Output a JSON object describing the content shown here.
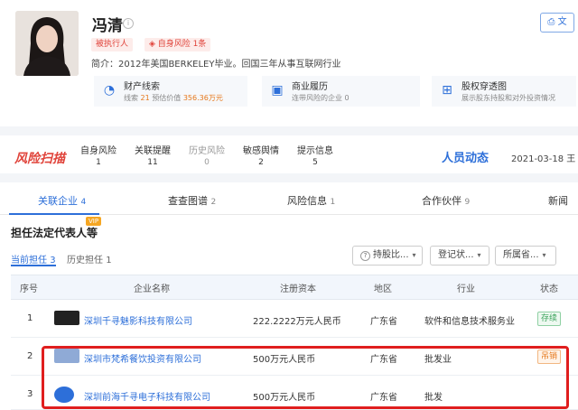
{
  "profile": {
    "name": "冯清",
    "tags": [
      "被执行人",
      "自身风险 1条"
    ],
    "intro": "简介：2012年美国BERKELEY毕业。回国三年从事互联网行业",
    "metrics": [
      {
        "icon": "finance-icon",
        "title": "财产线索",
        "line_prefix": "线索",
        "line_count": "21",
        "line_mid": "预估价值",
        "line_value": "356.36万元"
      },
      {
        "icon": "briefcase-icon",
        "title": "商业履历",
        "line_prefix": "连带风险的企业",
        "line_count": "0"
      },
      {
        "icon": "org-chart-icon",
        "title": "股权穿透图",
        "line_prefix": "展示股东持股和对外投资情况"
      }
    ],
    "doc_btn": "文"
  },
  "risk": {
    "logo": "风险扫描",
    "columns": [
      {
        "label": "自身风险",
        "value": "1"
      },
      {
        "label": "关联提醒",
        "value": "11"
      },
      {
        "label": "历史风险",
        "value": "0"
      },
      {
        "label": "敏感舆情",
        "value": "2"
      },
      {
        "label": "提示信息",
        "value": "5"
      }
    ],
    "people_label": "人员动态",
    "date": "2021-03-18 王"
  },
  "tabs": [
    {
      "label": "关联企业",
      "count": "4"
    },
    {
      "label": "查查图谱",
      "count": "2"
    },
    {
      "label": "风险信息",
      "count": "1"
    },
    {
      "label": "合作伙伴",
      "count": "9"
    },
    {
      "label": "新闻",
      "count": ""
    }
  ],
  "section": {
    "title": "担任法定代表人等",
    "vip": "VIP",
    "sub_tabs": [
      {
        "label": "当前担任",
        "count": "3"
      },
      {
        "label": "历史担任",
        "count": "1"
      }
    ],
    "filters": [
      "持股比...",
      "登记状...",
      "所属省..."
    ]
  },
  "table": {
    "headers": [
      "序号",
      "企业名称",
      "注册资本",
      "地区",
      "行业",
      "状态"
    ],
    "rows": [
      {
        "no": "1",
        "name": "深圳千寻魅影科技有限公司",
        "capital": "222.2222万元人民币",
        "region": "广东省",
        "industry": "软件和信息技术服务业",
        "status": "存续",
        "logo_color": "#222222"
      },
      {
        "no": "2",
        "name": "深圳市梵希餐饮投资有限公司",
        "capital": "500万元人民币",
        "region": "广东省",
        "industry": "批发业",
        "status": "吊销",
        "logo_color": "#6b8fc9"
      },
      {
        "no": "3",
        "name": "深圳前海千寻电子科技有限公司",
        "capital": "500万元人民币",
        "region": "广东省",
        "industry": "批发",
        "status": "",
        "logo_color": "#2d6fd9"
      }
    ]
  },
  "colors": {
    "accent": "#2d6fd9",
    "risk": "#e0433a",
    "highlight": "#e01e1e"
  }
}
